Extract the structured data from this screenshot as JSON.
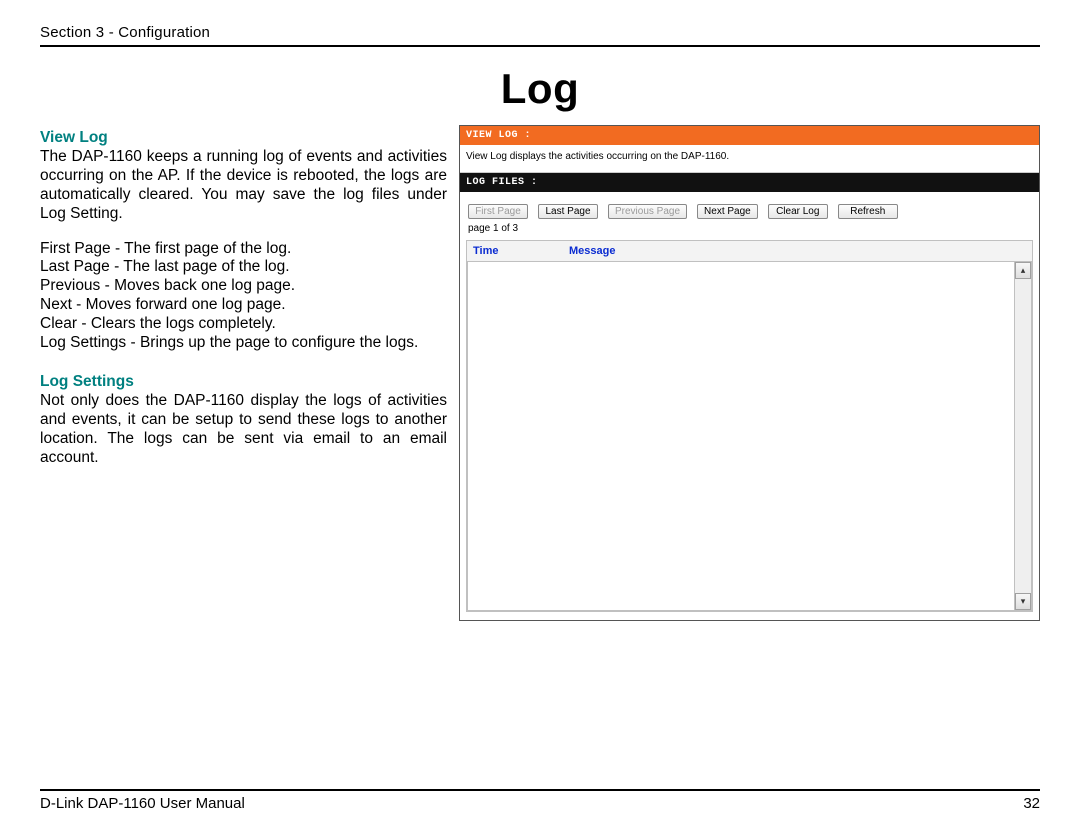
{
  "header": {
    "section": "Section 3 - Configuration"
  },
  "title": "Log",
  "left": {
    "view_log": {
      "heading": "View Log",
      "para1": "The DAP-1160 keeps a running log of events and activities occurring on the AP. If the device is rebooted, the logs are automatically cleared. You may save the log files under Log Setting.",
      "line_first": "First Page - The first page of the log.",
      "line_last": "Last Page - The last page of the log.",
      "line_prev": "Previous - Moves back one log page.",
      "line_next": "Next - Moves forward one log page.",
      "line_clear": "Clear - Clears the logs completely.",
      "line_settings": "Log Settings - Brings up the page to configure the logs."
    },
    "log_settings": {
      "heading": "Log Settings",
      "para": "Not only does the DAP-1160 display the logs of activities and events, it can be setup to send these logs to another location. The logs can be sent via email to an email account."
    }
  },
  "router_panel": {
    "orange_title": "VIEW LOG :",
    "description": "View Log displays the activities occurring on the DAP-1160.",
    "black_title": "LOG FILES :",
    "buttons": {
      "first": "First Page",
      "last": "Last Page",
      "previous": "Previous Page",
      "next": "Next Page",
      "clear": "Clear Log",
      "refresh": "Refresh"
    },
    "page_of": "page 1 of 3",
    "columns": {
      "time": "Time",
      "message": "Message"
    }
  },
  "footer": {
    "manual": "D-Link DAP-1160 User Manual",
    "page_number": "32"
  }
}
